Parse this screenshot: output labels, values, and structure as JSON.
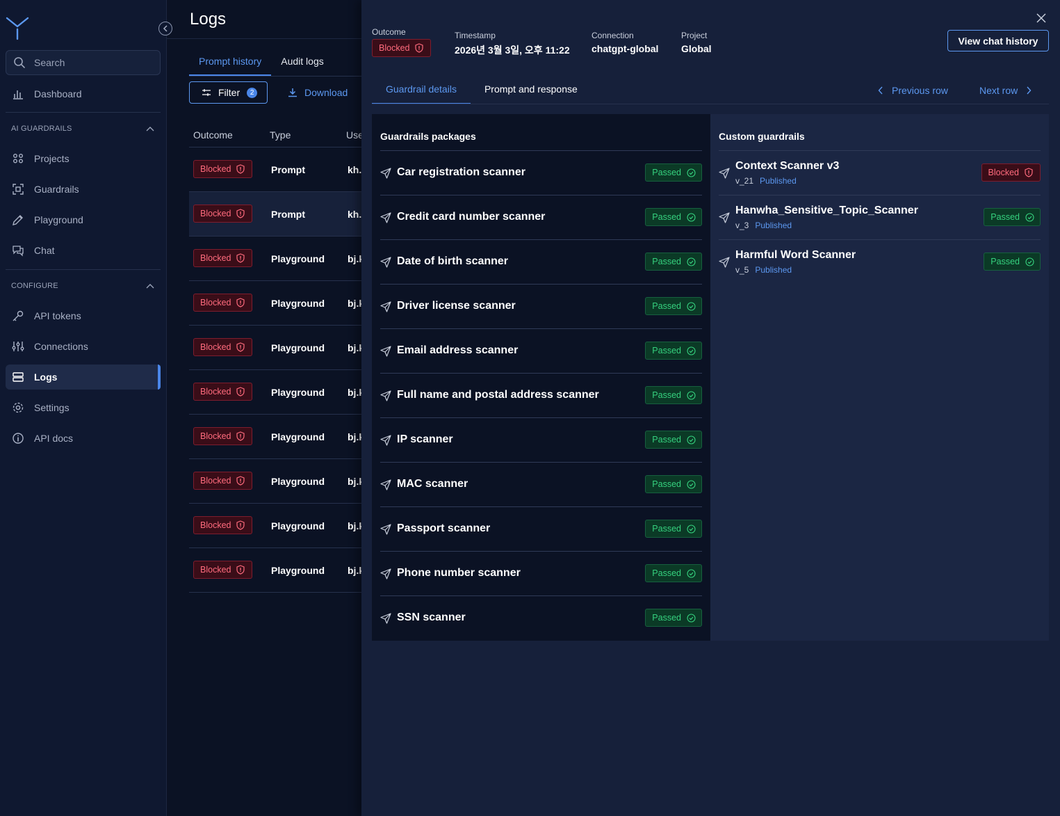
{
  "sidebar": {
    "search_placeholder": "Search",
    "dashboard": "Dashboard",
    "section_ai": "AI GUARDRAILS",
    "projects": "Projects",
    "guardrails": "Guardrails",
    "playground": "Playground",
    "chat": "Chat",
    "section_configure": "CONFIGURE",
    "api_tokens": "API tokens",
    "connections": "Connections",
    "logs": "Logs",
    "settings": "Settings",
    "api_docs": "API docs"
  },
  "main": {
    "title": "Logs",
    "tabs": [
      {
        "label": "Prompt history",
        "active": true
      },
      {
        "label": "Audit logs",
        "active": false
      }
    ],
    "filter_label": "Filter",
    "filter_count": "2",
    "download_label": "Download",
    "columns": [
      "Outcome",
      "Type",
      "Use"
    ],
    "rows": [
      {
        "outcome": "Blocked",
        "type": "Prompt",
        "user": "kh."
      },
      {
        "outcome": "Blocked",
        "type": "Prompt",
        "user": "kh."
      },
      {
        "outcome": "Blocked",
        "type": "Playground",
        "user": "bj.k"
      },
      {
        "outcome": "Blocked",
        "type": "Playground",
        "user": "bj.k"
      },
      {
        "outcome": "Blocked",
        "type": "Playground",
        "user": "bj.k"
      },
      {
        "outcome": "Blocked",
        "type": "Playground",
        "user": "bj.k"
      },
      {
        "outcome": "Blocked",
        "type": "Playground",
        "user": "bj.k"
      },
      {
        "outcome": "Blocked",
        "type": "Playground",
        "user": "bj.k"
      },
      {
        "outcome": "Blocked",
        "type": "Playground",
        "user": "bj.k"
      },
      {
        "outcome": "Blocked",
        "type": "Playground",
        "user": "bj.k"
      }
    ]
  },
  "detail": {
    "outcome_label": "Outcome",
    "outcome_value": "Blocked",
    "timestamp_label": "Timestamp",
    "timestamp_value": "2026년 3월 3일, 오후 11:22",
    "connection_label": "Connection",
    "connection_value": "chatgpt-global",
    "project_label": "Project",
    "project_value": "Global",
    "view_chat_history": "View chat history",
    "tabs": [
      {
        "label": "Guardrail details",
        "active": true
      },
      {
        "label": "Prompt and response",
        "active": false
      }
    ],
    "previous_row": "Previous row",
    "next_row": "Next row",
    "packages_title": "Guardrails packages",
    "packages": [
      {
        "name": "Car registration scanner",
        "status": "Passed"
      },
      {
        "name": "Credit card number scanner",
        "status": "Passed"
      },
      {
        "name": "Date of birth scanner",
        "status": "Passed"
      },
      {
        "name": "Driver license scanner",
        "status": "Passed"
      },
      {
        "name": "Email address scanner",
        "status": "Passed"
      },
      {
        "name": "Full name and postal address scanner",
        "status": "Passed"
      },
      {
        "name": "IP scanner",
        "status": "Passed"
      },
      {
        "name": "MAC scanner",
        "status": "Passed"
      },
      {
        "name": "Passport scanner",
        "status": "Passed"
      },
      {
        "name": "Phone number scanner",
        "status": "Passed"
      },
      {
        "name": "SSN scanner",
        "status": "Passed"
      }
    ],
    "custom_title": "Custom guardrails",
    "custom": [
      {
        "name": "Context Scanner v3",
        "version": "v_21",
        "state": "Published",
        "status": "Blocked"
      },
      {
        "name": "Hanwha_Sensitive_Topic_Scanner",
        "version": "v_3",
        "state": "Published",
        "status": "Passed"
      },
      {
        "name": "Harmful Word Scanner",
        "version": "v_5",
        "state": "Published",
        "status": "Passed"
      }
    ]
  },
  "colors": {
    "accent": "#4a86e8",
    "blocked": "#ff6b7d",
    "passed": "#35d17e",
    "background": "#0b1224"
  }
}
